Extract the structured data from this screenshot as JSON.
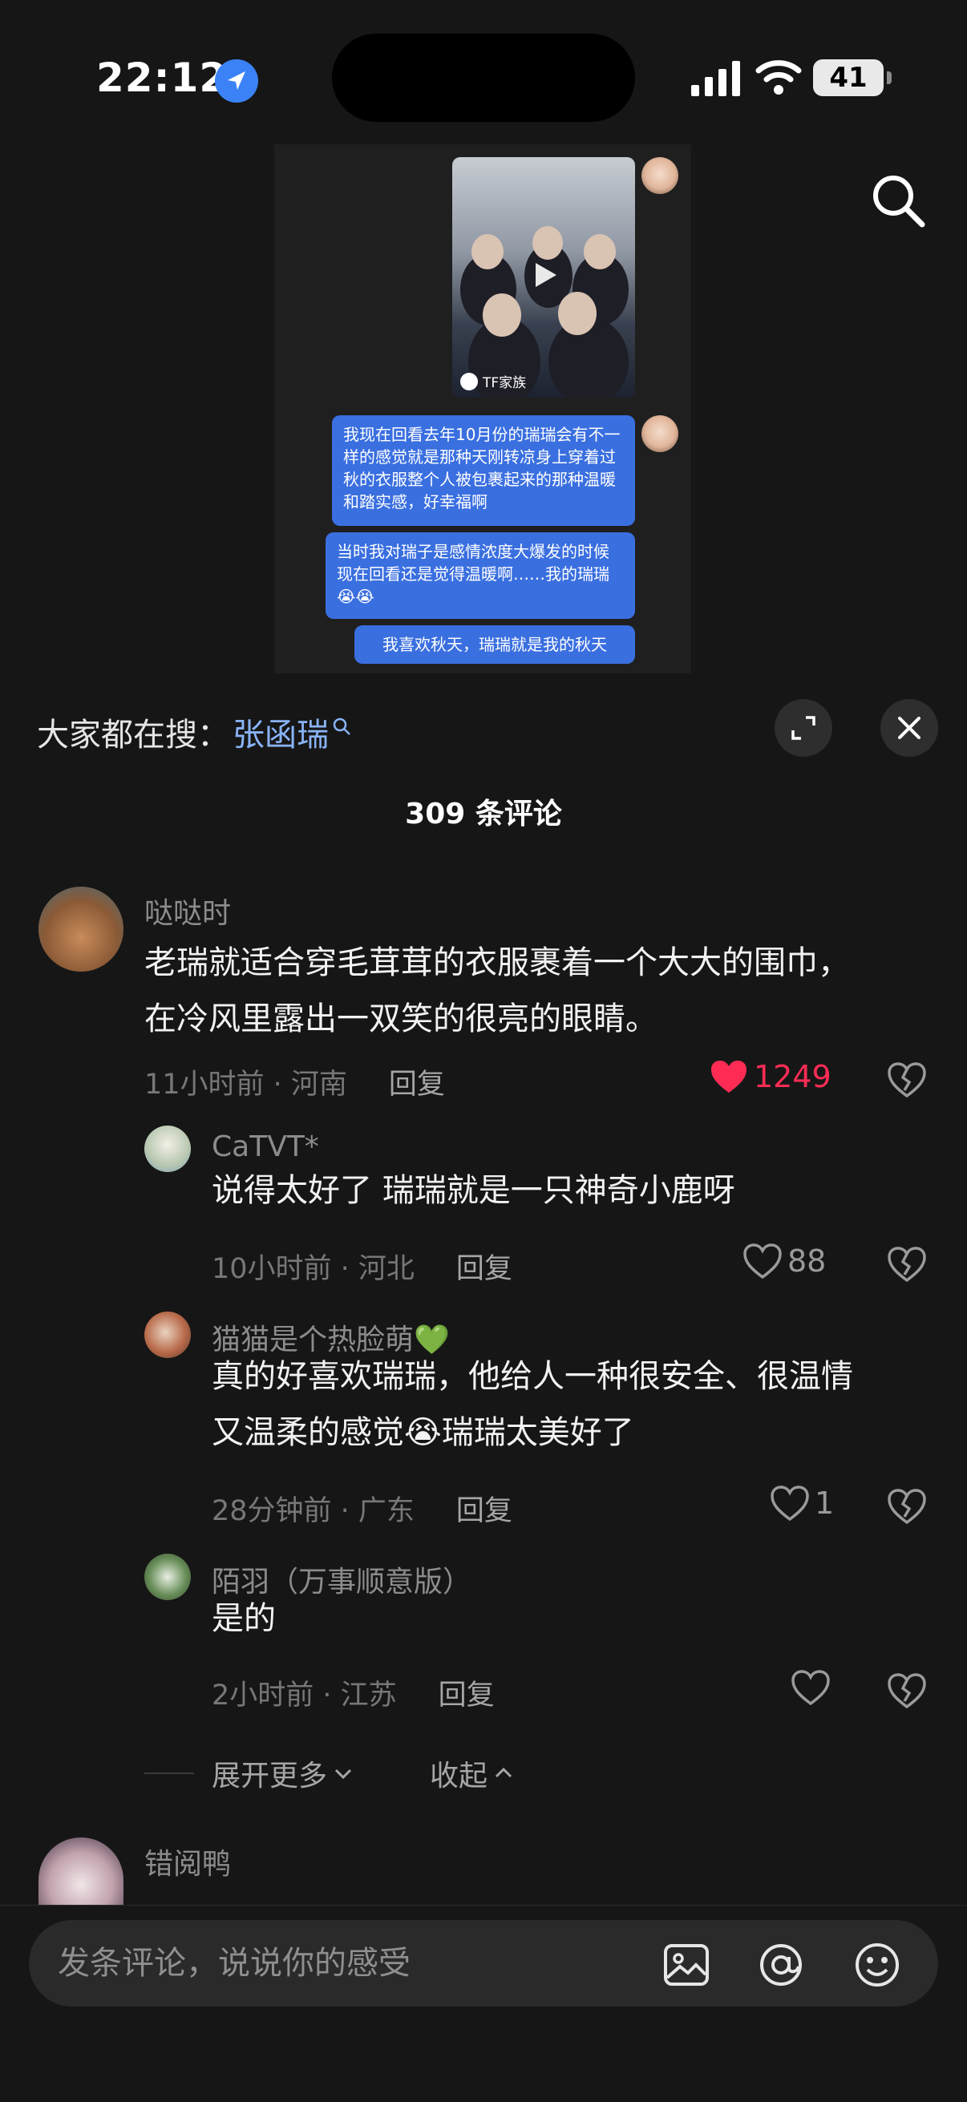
{
  "status_bar": {
    "time": "22:12",
    "battery": "41"
  },
  "video": {
    "thumb_label": "TF家族",
    "bubbles": [
      "我现在回看去年10月份的瑞瑞会有不一样的感觉就是那种天刚转凉身上穿着过秋的衣服整个人被包裹起来的那种温暖和踏实感，好幸福啊",
      "当时我对瑞子是感情浓度大爆发的时候现在回看还是觉得温暖啊……我的瑞瑞😭😭",
      "我喜欢秋天，瑞瑞就是我的秋天"
    ]
  },
  "sheet": {
    "hot_search_label": "大家都在搜：",
    "hot_search_term": "张函瑞",
    "comment_count": "309 条评论",
    "reply_label": "回复",
    "expand_more": "展开更多",
    "collapse": "收起"
  },
  "comments": [
    {
      "name": "哒哒时",
      "text_line1": "老瑞就适合穿毛茸茸的衣服裹着一个大大的围巾，",
      "text_line2": "在冷风里露出一双笑的很亮的眼睛。",
      "meta": "11小时前 · 河南",
      "likes": "1249",
      "liked": true
    }
  ],
  "replies": [
    {
      "name": "CaTVT*",
      "text_line1": "说得太好了 瑞瑞就是一只神奇小鹿呀",
      "text_line2": "",
      "meta": "10小时前 · 河北",
      "likes": "88"
    },
    {
      "name": "猫猫是个热脸萌💚",
      "text_line1": "真的好喜欢瑞瑞，他给人一种很安全、很温情",
      "text_line2": "又温柔的感觉😭瑞瑞太美好了",
      "meta": "28分钟前 · 广东",
      "likes": "1"
    },
    {
      "name": "陌羽（万事顺意版）",
      "text_line1": "是的",
      "text_line2": "",
      "meta": "2小时前 · 江苏",
      "likes": ""
    }
  ],
  "next_comment": {
    "name": "错阅鸭"
  },
  "input": {
    "placeholder": "发条评论，说说你的感受"
  },
  "icons": [
    "location-icon",
    "signal-icon",
    "wifi-icon",
    "search-icon",
    "expand-icon",
    "close-icon",
    "heart-icon",
    "dislike-icon",
    "image-icon",
    "at-icon",
    "emoji-icon",
    "chevron-down-icon",
    "chevron-up-icon"
  ],
  "colors": {
    "accent_like": "#fe2c55",
    "hot_search_term": "#8ab4f8",
    "bubble": "#3a6fe0"
  }
}
